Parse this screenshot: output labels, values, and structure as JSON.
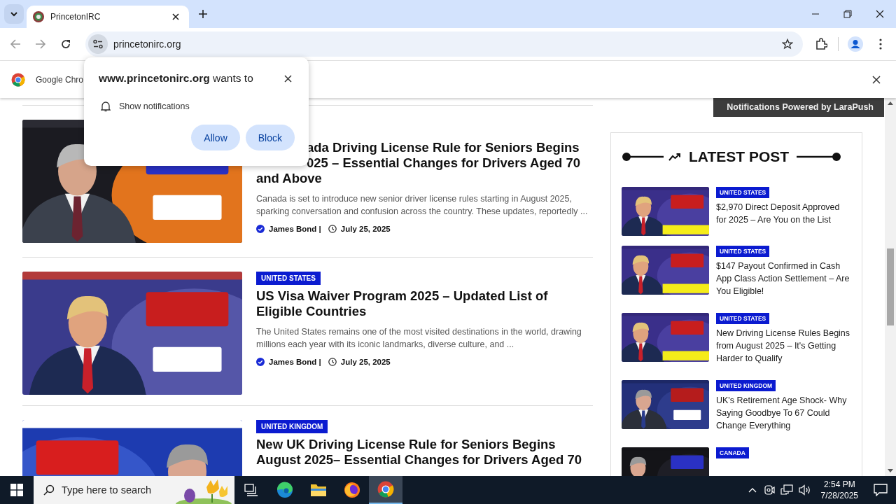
{
  "browser": {
    "tabs": [
      {
        "title": "PrincetonIRC",
        "selected": true
      }
    ],
    "url": "princetonirc.org",
    "infobar": {
      "text": "Google Chro"
    }
  },
  "permission_popup": {
    "title": "**www.princetonirc.org** wants to",
    "permission": "Show notifications",
    "buttons": [
      "Allow",
      "Block"
    ]
  },
  "page": {
    "powered_by": "Notifications Powered by **LaraPush**",
    "articles": [
      {
        "title_lines": [
          "ada Driving License Rule for Seniors Begins",
          "025 – Essential Changes for Drivers Aged 70",
          "and Above"
        ],
        "excerpt": "Canada is set to introduce new senior driver license rules starting in August 2025, sparking conversation and confusion across the country. These updates, reportedly ...",
        "author": "James Bond |",
        "date": "July 25, 2025"
      },
      {
        "category": "UNITED STATES",
        "title_lines": [
          "US Visa Waiver Program 2025 – Updated List of",
          "Eligible Countries"
        ],
        "excerpt": "The United States remains one of the most visited destinations in the world, drawing millions each year with its iconic landmarks, diverse culture, and ...",
        "author": "James Bond |",
        "date": "July 25, 2025"
      },
      {
        "category": "UNITED KINGDOM",
        "title_lines": [
          "New UK Driving License Rule for Seniors Begins",
          "August 2025– Essential Changes for Drivers Aged 70"
        ]
      }
    ],
    "sidebar": {
      "title": "LATEST POST",
      "posts": [
        {
          "category": "UNITED STATES",
          "title": "$2,970 Direct Deposit Approved for 2025 – Are You on the List"
        },
        {
          "category": "UNITED STATES",
          "title": "$147 Payout Confirmed in Cash App Class Action Settlement – Are You Eligible!"
        },
        {
          "category": "UNITED STATES",
          "title": "New Driving License Rules Begins from August 2025 – It's Getting Harder to Qualify"
        },
        {
          "category": "UNITED KINGDOM",
          "title": "UK's Retirement Age Shock- Why Saying Goodbye To 67 Could Change Everything"
        },
        {
          "category": "CANADA"
        }
      ]
    }
  },
  "taskbar": {
    "search_placeholder": "Type here to search",
    "apps": [
      {
        "kind": "task-view",
        "selected": false
      },
      {
        "kind": "edge",
        "selected": false
      },
      {
        "kind": "explorer",
        "selected": false
      },
      {
        "kind": "firefox",
        "selected": false
      },
      {
        "kind": "chrome",
        "selected": true
      }
    ],
    "time": "2:54 PM",
    "date": "7/28/2025"
  }
}
